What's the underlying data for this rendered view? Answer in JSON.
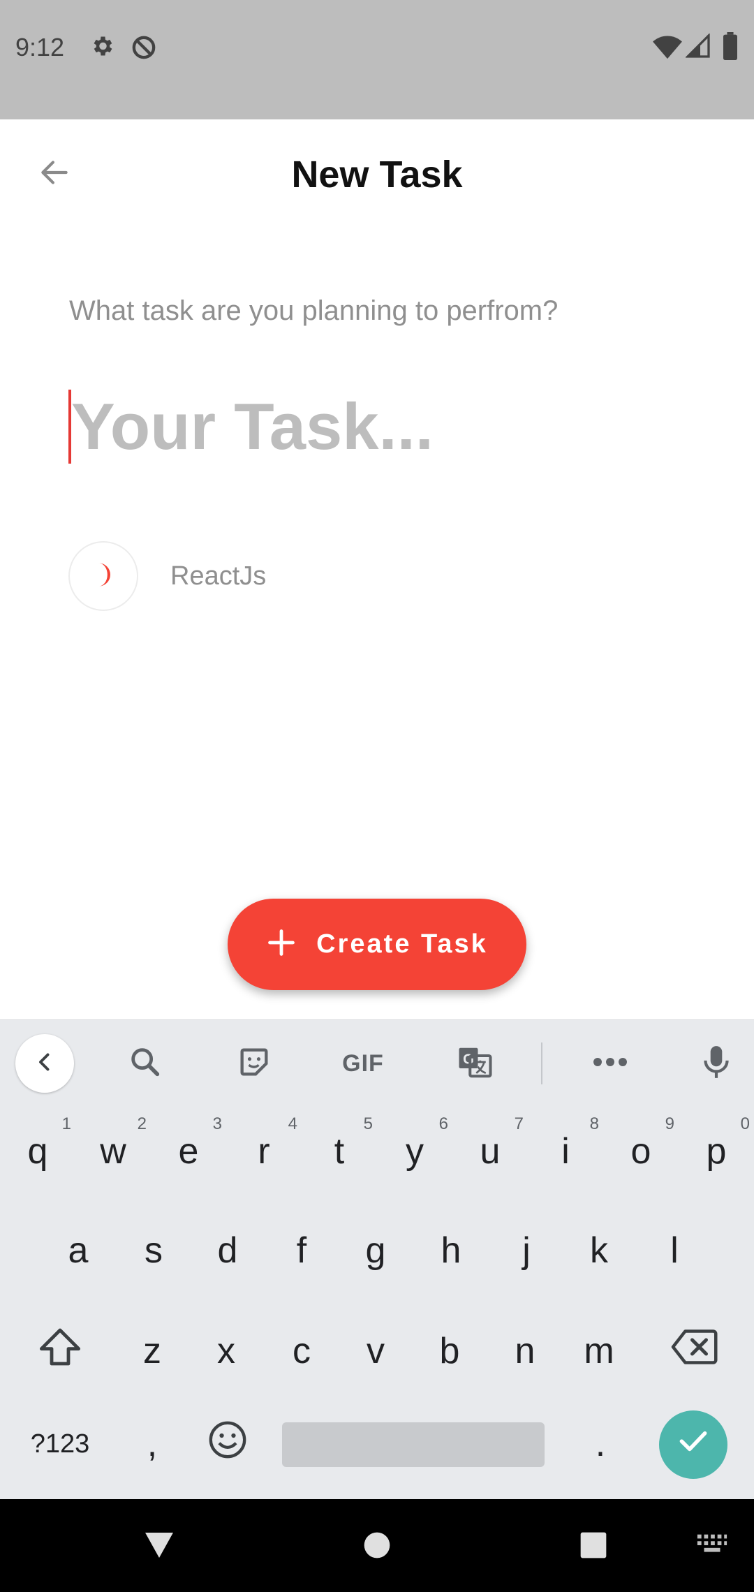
{
  "status_bar": {
    "time": "9:12",
    "icons": [
      "settings-icon",
      "data-saver-icon",
      "wifi-icon",
      "signal-icon",
      "battery-icon"
    ]
  },
  "header": {
    "title": "New Task",
    "back_icon": "arrow-back-icon"
  },
  "form": {
    "prompt": "What task are you planning to perfrom?",
    "task_input": {
      "value": "",
      "placeholder": "Your Task..."
    },
    "category": {
      "label": "ReactJs",
      "icon": "crescent-moon-icon",
      "color": "#f44336"
    }
  },
  "fab": {
    "label": "Create Task",
    "icon": "plus-icon",
    "color": "#f44336"
  },
  "keyboard": {
    "toolbar": [
      "chevron-left-icon",
      "search-icon",
      "sticker-icon",
      "GIF",
      "translate-icon",
      "more-icon",
      "mic-icon"
    ],
    "gif_label": "GIF",
    "row1": [
      {
        "k": "q",
        "h": "1"
      },
      {
        "k": "w",
        "h": "2"
      },
      {
        "k": "e",
        "h": "3"
      },
      {
        "k": "r",
        "h": "4"
      },
      {
        "k": "t",
        "h": "5"
      },
      {
        "k": "y",
        "h": "6"
      },
      {
        "k": "u",
        "h": "7"
      },
      {
        "k": "i",
        "h": "8"
      },
      {
        "k": "o",
        "h": "9"
      },
      {
        "k": "p",
        "h": "0"
      }
    ],
    "row2": [
      "a",
      "s",
      "d",
      "f",
      "g",
      "h",
      "j",
      "k",
      "l"
    ],
    "row3": [
      "z",
      "x",
      "c",
      "v",
      "b",
      "n",
      "m"
    ],
    "symbols_label": "?123",
    "comma": ",",
    "period": ".",
    "accent_color": "#4db6ac"
  },
  "nav_bar": {
    "icons": [
      "back-triangle-icon",
      "home-circle-icon",
      "recents-square-icon",
      "keyboard-switch-icon"
    ]
  }
}
